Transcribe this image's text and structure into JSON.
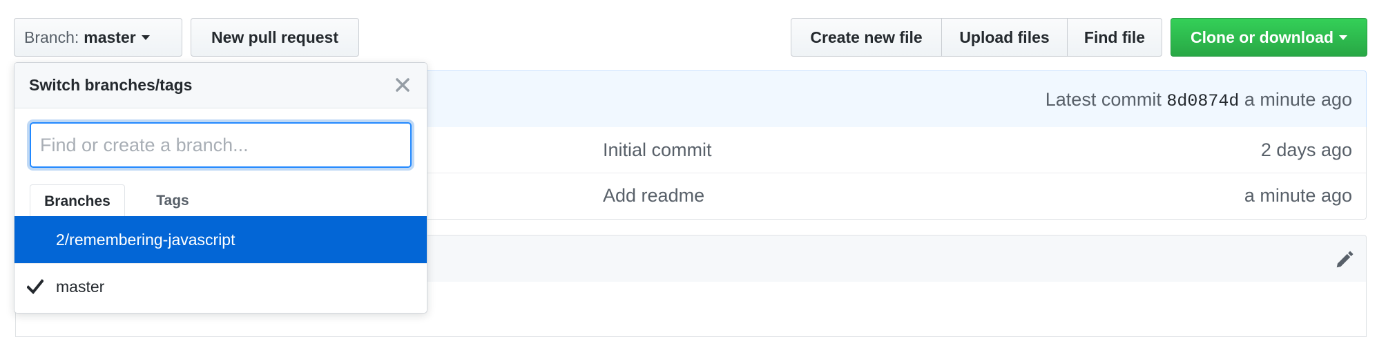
{
  "toolbar": {
    "branch_prefix": "Branch:",
    "branch_name": "master",
    "new_pull_request": "New pull request",
    "create_new_file": "Create new file",
    "upload_files": "Upload files",
    "find_file": "Find file",
    "clone_or_download": "Clone or download",
    "clone_color": "#28a745"
  },
  "commit_bar": {
    "latest_commit_label": "Latest commit",
    "sha": "8d0874d",
    "time": "a minute ago"
  },
  "files": [
    {
      "message": "Initial commit",
      "age": "2 days ago"
    },
    {
      "message": "Add readme",
      "age": "a minute ago"
    }
  ],
  "readme": {
    "edit_icon": "pencil-icon"
  },
  "branch_menu": {
    "title": "Switch branches/tags",
    "close_icon": "close-icon",
    "filter_placeholder": "Find or create a branch...",
    "filter_value": "",
    "tabs": [
      {
        "label": "Branches",
        "selected": true
      },
      {
        "label": "Tags",
        "selected": false
      }
    ],
    "items": [
      {
        "label": "2/remembering-javascript",
        "highlighted": true,
        "checked": false
      },
      {
        "label": "master",
        "highlighted": false,
        "checked": true
      }
    ],
    "highlight_color": "#0366d6"
  }
}
